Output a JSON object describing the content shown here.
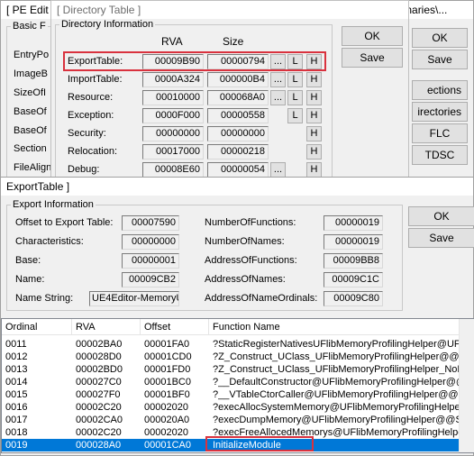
{
  "pe_editor": {
    "title": "[ PE Edit",
    "title_tail": "binaries\\...",
    "basic_group": "Basic F",
    "labels": [
      "EntryPo",
      "ImageB",
      "SizeOfI",
      "BaseOf",
      "BaseOf",
      "Section",
      "FileAlign"
    ],
    "buttons": {
      "ok": "OK",
      "save": "Save",
      "sections": "ections",
      "directories": "irectories",
      "flc": "FLC",
      "tdsc": "TDSC"
    }
  },
  "directory_table": {
    "title": "[ Directory Table ]",
    "group": "Directory Information",
    "col_rva": "RVA",
    "col_size": "Size",
    "rows": [
      {
        "label": "ExportTable:",
        "rva": "00009B90",
        "size": "00000794"
      },
      {
        "label": "ImportTable:",
        "rva": "0000A324",
        "size": "000000B4"
      },
      {
        "label": "Resource:",
        "rva": "00010000",
        "size": "000068A0"
      },
      {
        "label": "Exception:",
        "rva": "0000F000",
        "size": "00000558"
      },
      {
        "label": "Security:",
        "rva": "00000000",
        "size": "00000000"
      },
      {
        "label": "Relocation:",
        "rva": "00017000",
        "size": "00000218"
      },
      {
        "label": "Debug:",
        "rva": "00008E60",
        "size": "00000054"
      }
    ],
    "dots": "...",
    "l": "L",
    "h": "H",
    "ok": "OK",
    "save": "Save"
  },
  "export_table": {
    "title": "ExportTable ]",
    "group": "Export Information",
    "left_fields": [
      {
        "label": "Offset to Export Table:",
        "value": "00007590"
      },
      {
        "label": "Characteristics:",
        "value": "00000000"
      },
      {
        "label": "Base:",
        "value": "00000001"
      },
      {
        "label": "Name:",
        "value": "00009CB2"
      },
      {
        "label": "Name String:",
        "value": "UE4Editor-MemoryU"
      }
    ],
    "right_fields": [
      {
        "label": "NumberOfFunctions:",
        "value": "00000019"
      },
      {
        "label": "NumberOfNames:",
        "value": "00000019"
      },
      {
        "label": "AddressOfFunctions:",
        "value": "00009BB8"
      },
      {
        "label": "AddressOfNames:",
        "value": "00009C1C"
      },
      {
        "label": "AddressOfNameOrdinals:",
        "value": "00009C80"
      }
    ],
    "ok": "OK",
    "save": "Save",
    "list": {
      "headers": [
        "Ordinal",
        "RVA",
        "Offset",
        "Function Name"
      ],
      "rows": [
        [
          "0011",
          "00002BA0",
          "00001FA0",
          "?StaticRegisterNativesUFlibMemoryProfilingHelper@UFlibM"
        ],
        [
          "0012",
          "000028D0",
          "00001CD0",
          "?Z_Construct_UClass_UFlibMemoryProfilingHelper@@YAl"
        ],
        [
          "0013",
          "00002BD0",
          "00001FD0",
          "?Z_Construct_UClass_UFlibMemoryProfilingHelper_NoReg"
        ],
        [
          "0014",
          "000027C0",
          "00001BC0",
          "?__DefaultConstructor@UFlibMemoryProfilingHelper@@SA"
        ],
        [
          "0015",
          "000027F0",
          "00001BF0",
          "?__VTableCtorCaller@UFlibMemoryProfilingHelper@@SAF"
        ],
        [
          "0016",
          "00002C20",
          "00002020",
          "?execAllocSystemMemory@UFlibMemoryProfilingHelper@@"
        ],
        [
          "0017",
          "00002CA0",
          "000020A0",
          "?execDumpMemory@UFlibMemoryProfilingHelper@@SAXF"
        ],
        [
          "0018",
          "00002C20",
          "00002020",
          "?execFreeAllocedMemorys@UFlibMemoryProfilingHelper@"
        ],
        [
          "0019",
          "000028A0",
          "00001CA0",
          "InitializeModule"
        ]
      ],
      "selected_index": 8
    }
  }
}
